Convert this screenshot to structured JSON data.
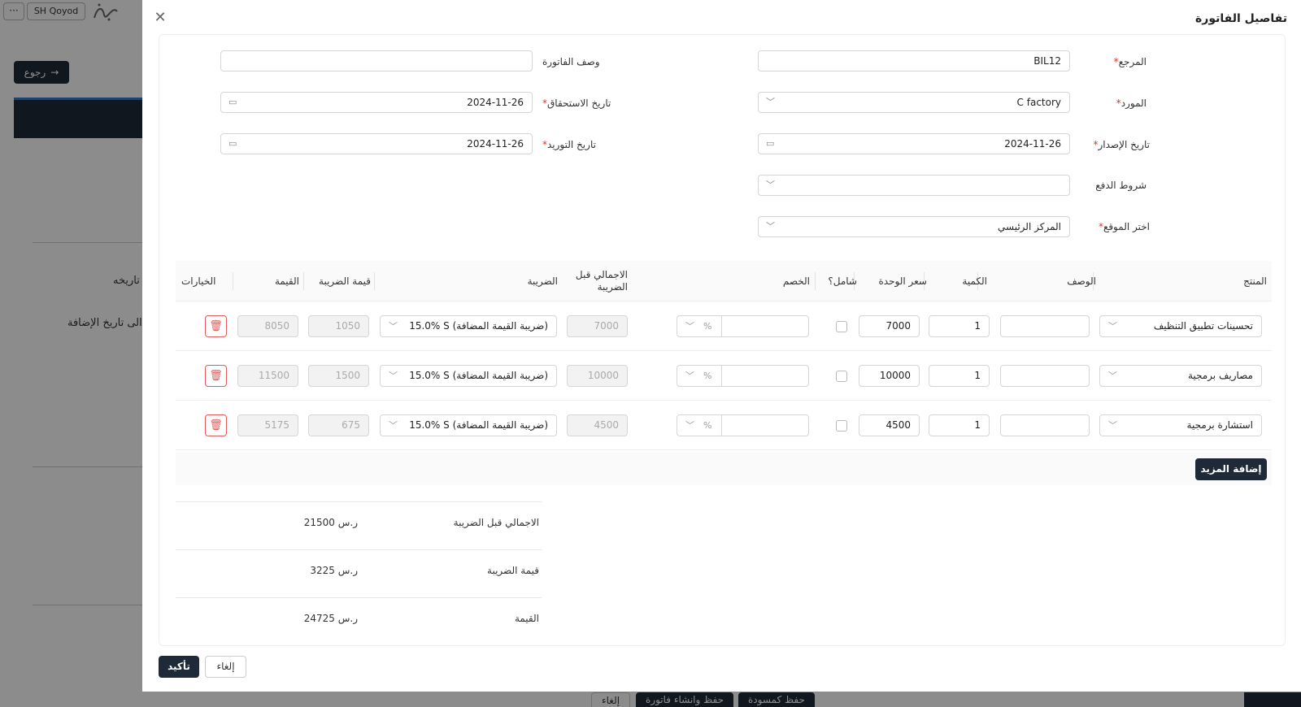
{
  "background": {
    "more_label": "···",
    "org_label": "SH Qoyod",
    "back_label": "رجوع",
    "date_label": "تاريخه",
    "added_date_label": "الى تاريخ الإضافة",
    "cancel_label": "إلغاء",
    "save_create_label": "حفظ وانشاء فاتورة",
    "save_draft_label": "حفظ كمسودة"
  },
  "modal": {
    "title": "تفاصيل الفاتورة",
    "close_icon": "close-icon"
  },
  "form": {
    "reference": {
      "label": "المرجع",
      "value": "BIL12"
    },
    "supplier": {
      "label": "المورد",
      "value": "C factory"
    },
    "issue_date": {
      "label": "تاريخ الإصدار",
      "value": "2024-11-26"
    },
    "payment_terms": {
      "label": "شروط الدفع",
      "value": ""
    },
    "location": {
      "label": "اختر الموقع",
      "value": "المركز الرئيسي"
    },
    "invoice_desc": {
      "label": "وصف الفاتورة",
      "value": ""
    },
    "due_date": {
      "label": "تاريخ الاستحقاق",
      "value": "2024-11-26"
    },
    "supply_date": {
      "label": "تاريخ التوريد",
      "value": "2024-11-26"
    }
  },
  "table": {
    "headers": {
      "product": "المنتج",
      "description": "الوصف",
      "quantity": "الكمية",
      "unit_price": "سعر الوحدة",
      "inclusive": "شامل؟",
      "discount": "الخصم",
      "subtotal": "الاجمالي قبل الضريبة",
      "tax": "الضريبة",
      "tax_value": "قيمة الضريبة",
      "amount": "القيمة",
      "options": "الخيارات"
    },
    "rows": [
      {
        "product": "تحسينات تطبيق التنظيف",
        "description": "",
        "quantity": "1",
        "unit_price": "7000",
        "discount": "",
        "discount_type": "%",
        "subtotal": "7000",
        "tax": "15.0% S (ضريبة القيمة المضافة)",
        "tax_value": "1050",
        "amount": "8050"
      },
      {
        "product": "مصاريف برمجية",
        "description": "",
        "quantity": "1",
        "unit_price": "10000",
        "discount": "",
        "discount_type": "%",
        "subtotal": "10000",
        "tax": "15.0% S (ضريبة القيمة المضافة)",
        "tax_value": "1500",
        "amount": "11500"
      },
      {
        "product": "استشارة برمجية",
        "description": "",
        "quantity": "1",
        "unit_price": "4500",
        "discount": "",
        "discount_type": "%",
        "subtotal": "4500",
        "tax": "15.0% S (ضريبة القيمة المضافة)",
        "tax_value": "675",
        "amount": "5175"
      }
    ],
    "add_more_label": "إضافة المزيد"
  },
  "totals": {
    "subtotal": {
      "label": "الاجمالي قبل الضريبة",
      "value": "21500 ر.س"
    },
    "tax": {
      "label": "قيمة الضريبة",
      "value": "3225 ر.س"
    },
    "total": {
      "label": "القيمة",
      "value": "24725 ر.س"
    }
  },
  "footer": {
    "confirm_label": "تأكيد",
    "cancel_label": "إلغاء"
  },
  "colors": {
    "primary_dark": "#1e2a38",
    "danger": "#e35b5b",
    "required": "#d33333"
  }
}
